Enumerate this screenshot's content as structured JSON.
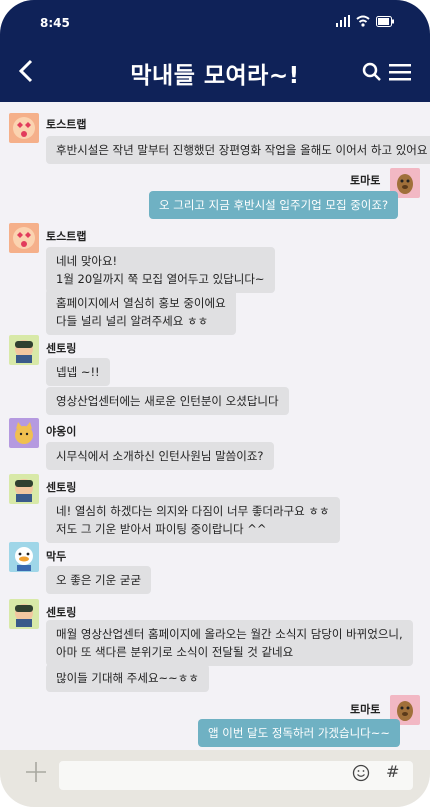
{
  "status": {
    "time": "8:45"
  },
  "header": {
    "title": "막내들 모여라~!"
  },
  "messages": {
    "m1": {
      "name": "토스트랩",
      "text": "후반시설은 작년 말부터 진행했던 장편영화 작업을 올해도 이어서 하고 있어요"
    },
    "m2": {
      "name": "토마토",
      "text": "오 그리고 지금 후반시설 입주기업 모집 중이죠?"
    },
    "m3": {
      "name": "토스트랩",
      "line1": "네네 맞아요!",
      "line2": "1월 20일까지 쭉 모집 열어두고 있답니다~",
      "line3": "홈페이지에서 열심히 홍보 중이에요",
      "line4": "다들 널리 널리 알려주세요 ㅎㅎ"
    },
    "m4": {
      "name": "센토링",
      "text1": "넵넵 ~!!",
      "text2": "영상산업센터에는 새로운 인턴분이 오셨답니다"
    },
    "m5": {
      "name": "야옹이",
      "text": "시무식에서 소개하신 인턴사원님 말씀이죠?"
    },
    "m6": {
      "name": "센토링",
      "line1": "네! 열심히 하겠다는 의지와 다짐이 너무 좋더라구요 ㅎㅎ",
      "line2": "저도 그 기운 받아서 파이팅 중이랍니다 ^^"
    },
    "m7": {
      "name": "막두",
      "text": "오 좋은 기운 굳굳"
    },
    "m8": {
      "name": "센토링",
      "line1": "매월 영상산업센터 홈페이지에 올라오는 월간 소식지 담당이 바뀌었으니,",
      "line2": "아마 또 색다른 분위기로 소식이 전달될 것 같네요",
      "line3": "많이들 기대해 주세요~~ㅎㅎ"
    },
    "m9": {
      "name": "토마토",
      "text": "앱 이번 달도 정독하러 가겠습니다~~"
    }
  },
  "input": {
    "placeholder": "",
    "hash": "#"
  },
  "icons": {
    "back": "back-arrow-icon",
    "search": "search-icon",
    "menu": "menu-icon",
    "plus": "plus-icon",
    "emoji": "smile-icon"
  },
  "colors": {
    "header": "#0f2258",
    "bubble_mine": "#6fb1c3",
    "bubble_other": "#e0e0e2"
  }
}
